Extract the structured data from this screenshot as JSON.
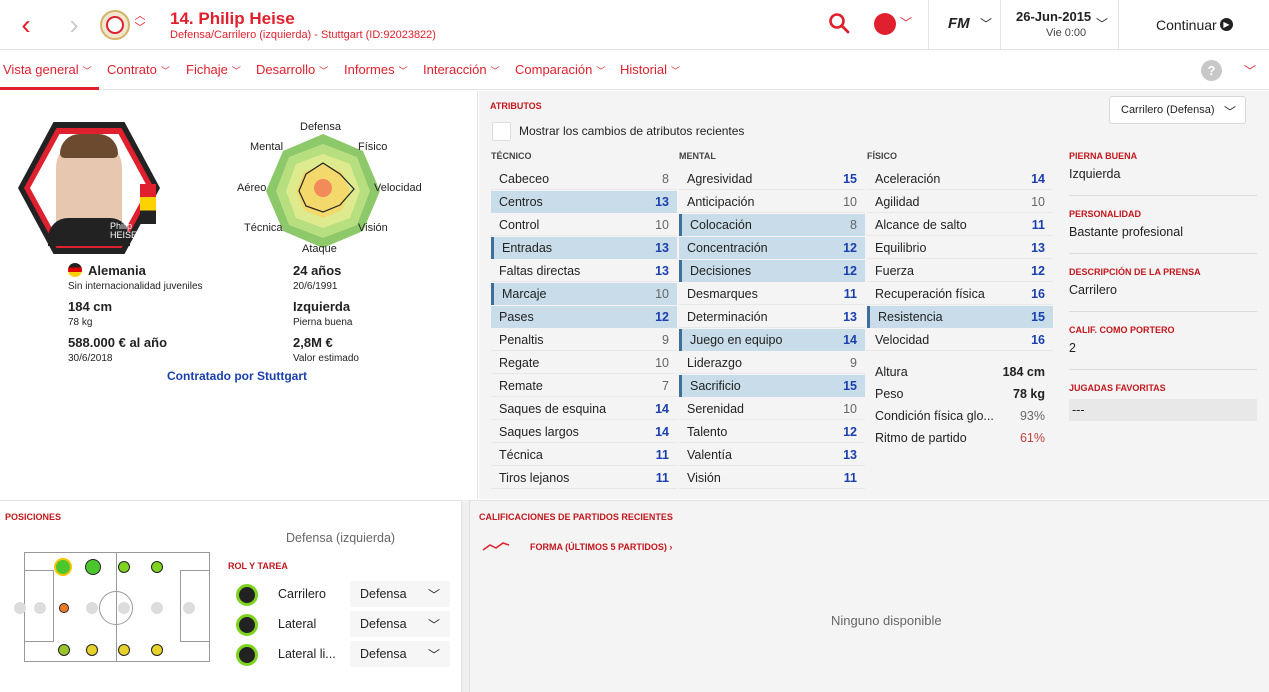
{
  "header": {
    "player_title": "14. Philip Heise",
    "player_sub": "Defensa/Carrilero (izquierda) - Stuttgart (ID:92023822)",
    "fm_label": "FM",
    "date": "26-Jun-2015",
    "day": "Vie 0:00",
    "continue_label": "Continuar"
  },
  "nav": {
    "tabs": [
      "Vista general",
      "Contrato",
      "Fichaje",
      "Desarrollo",
      "Informes",
      "Interacción",
      "Comparación",
      "Historial"
    ]
  },
  "profile": {
    "jersey_name": "Philip HEISE",
    "nationality": "Alemania",
    "intl_caps": "Sin internacionalidad juveniles",
    "height": "184 cm",
    "weight": "78 kg",
    "wage": "588.000 € al año",
    "contract_end": "30/6/2018",
    "age": "24 años",
    "dob": "20/6/1991",
    "foot": "Izquierda",
    "foot_label": "Pierna buena",
    "value": "2,8M €",
    "value_label": "Valor estimado",
    "signed_by": "Contratado por Stuttgart",
    "radar_labels": {
      "defensa": "Defensa",
      "fisico": "Físico",
      "velocidad": "Velocidad",
      "vision": "Visión",
      "ataque": "Ataque",
      "tecnica": "Técnica",
      "aereo": "Aéreo",
      "mental": "Mental"
    }
  },
  "attributes": {
    "section_title": "ATRIBUTOS",
    "role_select": "Carrilero (Defensa)",
    "show_changes": "Mostrar los cambios de atributos recientes",
    "col_tecnico": "TÉCNICO",
    "col_mental": "MENTAL",
    "col_fisico": "FÍSICO",
    "tecnico": [
      {
        "n": "Cabeceo",
        "v": "8"
      },
      {
        "n": "Centros",
        "v": "13"
      },
      {
        "n": "Control",
        "v": "10"
      },
      {
        "n": "Entradas",
        "v": "13"
      },
      {
        "n": "Faltas directas",
        "v": "13"
      },
      {
        "n": "Marcaje",
        "v": "10"
      },
      {
        "n": "Pases",
        "v": "12"
      },
      {
        "n": "Penaltis",
        "v": "9"
      },
      {
        "n": "Regate",
        "v": "10"
      },
      {
        "n": "Remate",
        "v": "7"
      },
      {
        "n": "Saques de esquina",
        "v": "14"
      },
      {
        "n": "Saques largos",
        "v": "14"
      },
      {
        "n": "Técnica",
        "v": "11"
      },
      {
        "n": "Tiros lejanos",
        "v": "11"
      }
    ],
    "mental": [
      {
        "n": "Agresividad",
        "v": "15"
      },
      {
        "n": "Anticipación",
        "v": "10"
      },
      {
        "n": "Colocación",
        "v": "8"
      },
      {
        "n": "Concentración",
        "v": "12"
      },
      {
        "n": "Decisiones",
        "v": "12"
      },
      {
        "n": "Desmarques",
        "v": "11"
      },
      {
        "n": "Determinación",
        "v": "13"
      },
      {
        "n": "Juego en equipo",
        "v": "14"
      },
      {
        "n": "Liderazgo",
        "v": "9"
      },
      {
        "n": "Sacrificio",
        "v": "15"
      },
      {
        "n": "Serenidad",
        "v": "10"
      },
      {
        "n": "Talento",
        "v": "12"
      },
      {
        "n": "Valentía",
        "v": "13"
      },
      {
        "n": "Visión",
        "v": "11"
      }
    ],
    "fisico": [
      {
        "n": "Aceleración",
        "v": "14"
      },
      {
        "n": "Agilidad",
        "v": "10"
      },
      {
        "n": "Alcance de salto",
        "v": "11"
      },
      {
        "n": "Equilibrio",
        "v": "13"
      },
      {
        "n": "Fuerza",
        "v": "12"
      },
      {
        "n": "Recuperación física",
        "v": "16"
      },
      {
        "n": "Resistencia",
        "v": "15"
      },
      {
        "n": "Velocidad",
        "v": "16"
      }
    ],
    "extra": [
      {
        "n": "Altura",
        "v": "184 cm"
      },
      {
        "n": "Peso",
        "v": "78 kg"
      },
      {
        "n": "Condición física glo...",
        "v": "93%"
      },
      {
        "n": "Ritmo de partido",
        "v": "61%"
      }
    ]
  },
  "right_info": {
    "foot_h": "PIERNA BUENA",
    "foot_v": "Izquierda",
    "pers_h": "PERSONALIDAD",
    "pers_v": "Bastante profesional",
    "press_h": "DESCRIPCIÓN DE LA PRENSA",
    "press_v": "Carrilero",
    "gk_h": "CALIF. COMO PORTERO",
    "gk_v": "2",
    "moves_h": "JUGADAS FAVORITAS",
    "moves_v": "---"
  },
  "positions": {
    "title": "POSICIONES",
    "current": "Defensa (izquierda)",
    "role_title": "ROL Y TAREA",
    "roles": [
      {
        "name": "Carrilero",
        "duty": "Defensa"
      },
      {
        "name": "Lateral",
        "duty": "Defensa"
      },
      {
        "name": "Lateral li...",
        "duty": "Defensa"
      }
    ]
  },
  "matches": {
    "title": "CALIFICACIONES DE PARTIDOS RECIENTES",
    "form_label": "FORMA (ÚLTIMOS 5 PARTIDOS) ›",
    "empty": "Ninguno disponible"
  },
  "colors": {
    "accent": "#e0202e",
    "highlight": "#c8dde9",
    "blue": "#1a3fae"
  }
}
